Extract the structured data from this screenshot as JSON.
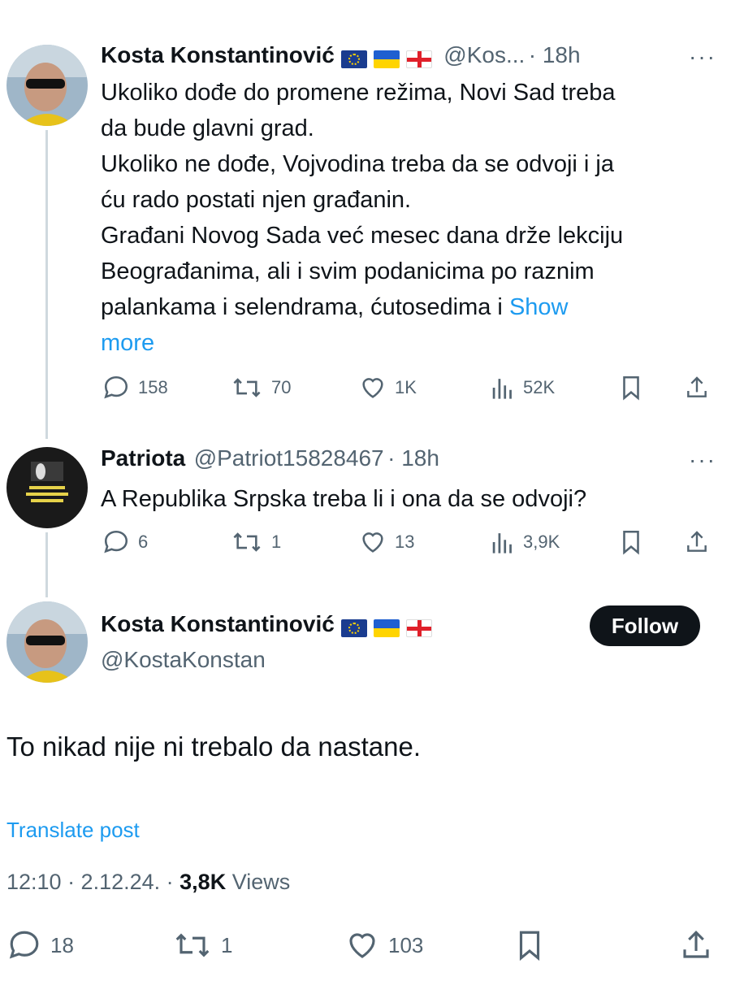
{
  "tweet1": {
    "name": "Kosta Konstantinović",
    "handle": "@Kos...",
    "time": "· 18h",
    "lines": [
      "Ukoliko dođe do promene režima, Novi Sad treba",
      "da bude glavni grad.",
      "Ukoliko ne dođe, Vojvodina treba da se odvoji i ja",
      "ću rado postati njen građanin.",
      "Građani Novog Sada već mesec dana drže lekciju",
      "Beograđanima, ali i svim podanicima po raznim",
      "palankama i selendrama, ćutosedima i"
    ],
    "show_more_1": "Show",
    "show_more_2": "more",
    "replies": "158",
    "retweets": "70",
    "likes": "1K",
    "views": "52K"
  },
  "tweet2": {
    "name": "Patriota",
    "handle": "@Patriot15828467",
    "time": "· 18h",
    "text": "A Republika Srpska treba li i ona da se odvoji?",
    "replies": "6",
    "retweets": "1",
    "likes": "13",
    "views": "3,9K"
  },
  "main": {
    "name": "Kosta Konstantinović",
    "handle": "@KostaKonstan",
    "follow_label": "Follow",
    "text": "To nikad nije ni trebalo da nastane.",
    "translate": "Translate post",
    "timestamp": "12:10 · 2.12.24. ·",
    "views_count": "3,8K",
    "views_label": "Views",
    "replies": "18",
    "retweets": "1",
    "likes": "103"
  },
  "colors": {
    "accent": "#1d9bf0",
    "muted": "#536471",
    "text": "#0f1419"
  }
}
